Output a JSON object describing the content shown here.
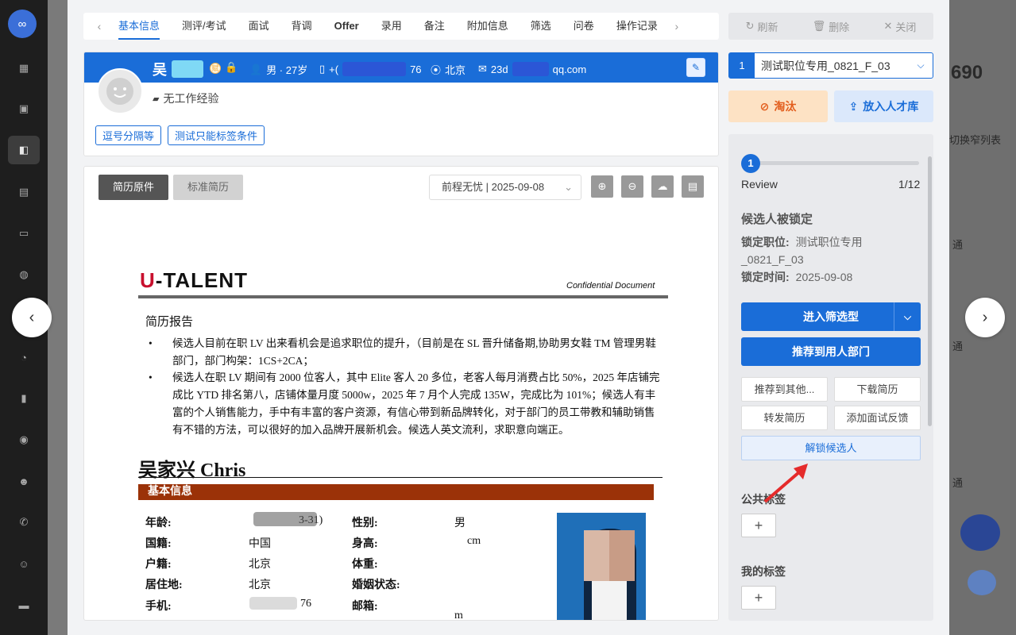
{
  "tabs": {
    "items": [
      "基本信息",
      "测评/考试",
      "面试",
      "背调",
      "Offer",
      "录用",
      "备注",
      "附加信息",
      "筛选",
      "问卷",
      "操作记录"
    ],
    "active_index": 0
  },
  "toolbar": {
    "refresh": "刷新",
    "delete": "删除",
    "close": "关闭"
  },
  "candidate": {
    "name": "吴",
    "badge": "赋",
    "gender_age": "男 · 27岁",
    "phone": "+(",
    "phone_suffix": "76",
    "city": "北京",
    "email_prefix": "23d",
    "email_suffix": "qq.com",
    "work_experience": "无工作经验",
    "tags": [
      "逗号分隔等",
      "测试只能标签条件"
    ]
  },
  "resume_view": {
    "original_label": "简历原件",
    "standard_label": "标准简历",
    "source": "前程无忧 | 2025-09-08"
  },
  "resume_doc": {
    "logo_u": "U",
    "logo_rest": "-TALENT",
    "confidential": "Confidential Document",
    "heading": "简历报告",
    "bullets": [
      "候选人目前在职 LV 出来看机会是追求职位的提升，（目前是在 SL 晋升储备期,协助男女鞋 TM 管理男鞋部门，部门构架：1CS+2CA；",
      "候选人在职 LV 期间有 2000 位客人，其中 Elite 客人 20 多位，老客人每月消费占比 50%，2025 年店铺完成比 YTD 排名第八，店铺体量月度 5000w，2025 年 7 月个人完成 135W，完成比为 101%；候选人有丰富的个人销售能力，手中有丰富的客户资源，有信心带到新品牌转化，对于部门的员工带教和辅助销售有不错的方法，可以很好的加入品牌开展新机会。候选人英文流利，求职意向端正。"
    ],
    "person_name": "吴家兴 Chris",
    "section": "基本信息",
    "fields_left": [
      {
        "label": "年龄:",
        "value": "3-31)"
      },
      {
        "label": "国籍:",
        "value": "中国"
      },
      {
        "label": "户籍:",
        "value": "北京"
      },
      {
        "label": "居住地:",
        "value": "北京"
      },
      {
        "label": "手机:",
        "value": "76"
      }
    ],
    "fields_right": [
      {
        "label": "性别:",
        "value": "男"
      },
      {
        "label": "身高:",
        "value": "cm"
      },
      {
        "label": "体重:",
        "value": ""
      },
      {
        "label": "婚姻状态:",
        "value": ""
      },
      {
        "label": "邮箱:",
        "value": "m"
      }
    ]
  },
  "job_select": {
    "index": "1",
    "title": "测试职位专用_0821_F_03"
  },
  "actions": {
    "reject": "淘汰",
    "pool": "放入人才库"
  },
  "progress": {
    "step": "1",
    "stage": "Review",
    "count": "1/12",
    "fraction": 0.083
  },
  "lock_info": {
    "title": "候选人被锁定",
    "position_label": "锁定职位:",
    "position_value": "测试职位专用_0821_F_03",
    "time_label": "锁定时间:",
    "time_value": "2025-09-08"
  },
  "side_buttons": {
    "enter_screening": "进入筛选型",
    "recommend_dept": "推荐到用人部门",
    "recommend_other": "推荐到其他...",
    "download": "下载简历",
    "forward": "转发简历",
    "feedback": "添加面试反馈",
    "unlock": "解锁候选人"
  },
  "labels": {
    "public": "公共标签",
    "mine": "我的标签"
  },
  "background": {
    "number": "690",
    "switch": "切换窄列表",
    "tong": "通"
  },
  "colors": {
    "primary": "#1a6dd8",
    "reject": "#e25c1b",
    "section": "#9b3208",
    "arrow": "#e52b2b"
  }
}
